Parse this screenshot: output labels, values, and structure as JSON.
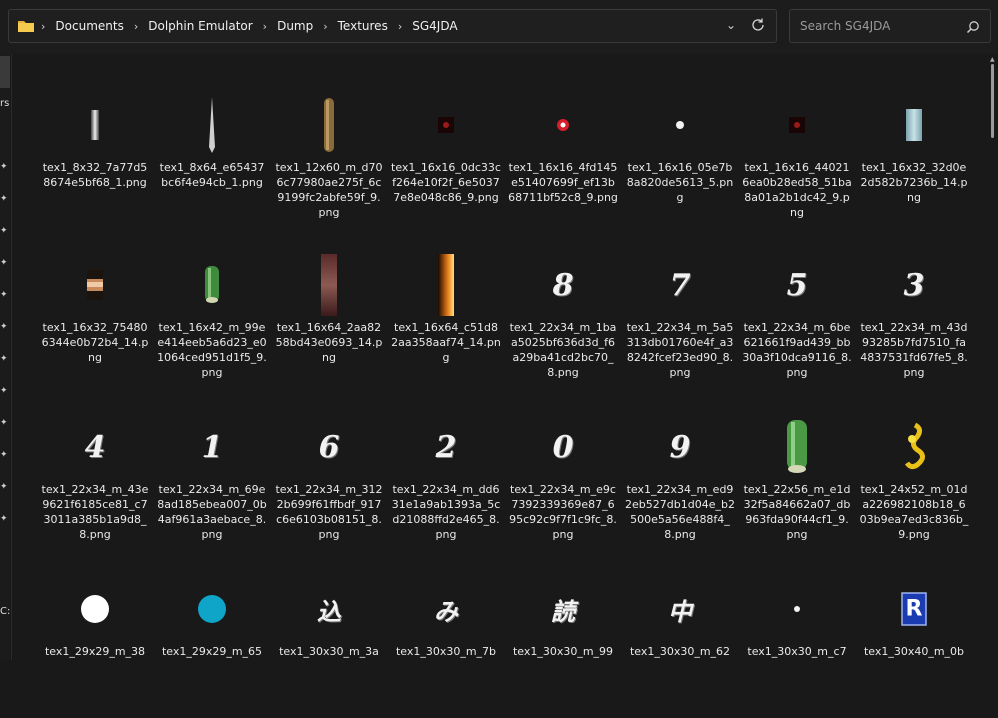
{
  "breadcrumbs": [
    "Documents",
    "Dolphin Emulator",
    "Dump",
    "Textures",
    "SG4JDA"
  ],
  "search": {
    "placeholder": "Search SG4JDA"
  },
  "left_pane": {
    "cut_text_1": "rs",
    "cut_text_2": "C:"
  },
  "icons": {
    "folder": "folder-icon",
    "dropdown": "chevron-down-icon",
    "refresh": "refresh-icon",
    "search": "search-icon",
    "pin": "pin-icon"
  },
  "files": [
    {
      "name": "tex1_8x32_7a77d58674e5bf68_1.png",
      "thumb": "bar-gray"
    },
    {
      "name": "tex1_8x64_e65437bc6f4e94cb_1.png",
      "thumb": "spike"
    },
    {
      "name": "tex1_12x60_m_d706c77980ae275f_6c9199fc2abfe59f_9.png",
      "thumb": "rod-brown"
    },
    {
      "name": "tex1_16x16_0dc33cf264e10f2f_6e50377e8e048c86_9.png",
      "thumb": "dot-dark-red"
    },
    {
      "name": "tex1_16x16_4fd145e51407699f_ef13b68711bf52c8_9.png",
      "thumb": "dot-red-glow"
    },
    {
      "name": "tex1_16x16_05e7b8a820de5613_5.png",
      "thumb": "dot-white"
    },
    {
      "name": "tex1_16x16_440216ea0b28ed58_51ba8a01a2b1dc42_9.png",
      "thumb": "dot-dark-red"
    },
    {
      "name": "tex1_16x32_32d0e2d582b7236b_14.png",
      "thumb": "bar-blue"
    },
    {
      "name": "tex1_16x32_754806344e0b72b4_14.png",
      "thumb": "bar-copper"
    },
    {
      "name": "tex1_16x42_m_99ee414eeb5a6d23_e01064ced951d1f5_9.png",
      "thumb": "cylinder-green-small"
    },
    {
      "name": "tex1_16x64_2aa8258bd43e0693_14.png",
      "thumb": "bar-dark-red"
    },
    {
      "name": "tex1_16x64_c51d82aa358aaf74_14.png",
      "thumb": "bar-fire"
    },
    {
      "name": "tex1_22x34_m_1baa5025bf636d3d_f6a29ba41cd2bc70_8.png",
      "thumb": "glyph",
      "glyph": "8"
    },
    {
      "name": "tex1_22x34_m_5a5313db01760e4f_a38242fcef23ed90_8.png",
      "thumb": "glyph",
      "glyph": "7"
    },
    {
      "name": "tex1_22x34_m_6be621661f9ad439_bb30a3f10dca9116_8.png",
      "thumb": "glyph",
      "glyph": "5"
    },
    {
      "name": "tex1_22x34_m_43d93285b7fd7510_fa4837531fd67fe5_8.png",
      "thumb": "glyph",
      "glyph": "3"
    },
    {
      "name": "tex1_22x34_m_43e9621f6185ce81_c73011a385b1a9d8_8.png",
      "thumb": "glyph",
      "glyph": "4"
    },
    {
      "name": "tex1_22x34_m_69e8ad185ebea007_0b4af961a3aebace_8.png",
      "thumb": "glyph",
      "glyph": "1"
    },
    {
      "name": "tex1_22x34_m_3122b699f61ffbdf_917c6e6103b08151_8.png",
      "thumb": "glyph",
      "glyph": "6"
    },
    {
      "name": "tex1_22x34_m_dd631e1a9ab1393a_5cd21088ffd2e465_8.png",
      "thumb": "glyph",
      "glyph": "2"
    },
    {
      "name": "tex1_22x34_m_e9c7392339369e87_695c92c9f7f1c9fc_8.png",
      "thumb": "glyph",
      "glyph": "0"
    },
    {
      "name": "tex1_22x34_m_ed92eb527db1d04e_b2500e5a56e488f4_8.png",
      "thumb": "glyph",
      "glyph": "9"
    },
    {
      "name": "tex1_22x56_m_e1d32f5a84662a07_db963fda90f44cf1_9.png",
      "thumb": "cylinder-green-large"
    },
    {
      "name": "tex1_24x52_m_01da226982108b18_603b9ea7ed3c836b_9.png",
      "thumb": "gold-swirl"
    },
    {
      "name": "tex1_29x29_m_38",
      "thumb": "circle-white"
    },
    {
      "name": "tex1_29x29_m_65",
      "thumb": "circle-cyan"
    },
    {
      "name": "tex1_30x30_m_3a",
      "thumb": "glyph",
      "glyph": "込"
    },
    {
      "name": "tex1_30x30_m_7b",
      "thumb": "glyph",
      "glyph": "み"
    },
    {
      "name": "tex1_30x30_m_99",
      "thumb": "glyph",
      "glyph": "読"
    },
    {
      "name": "tex1_30x30_m_62",
      "thumb": "glyph",
      "glyph": "中"
    },
    {
      "name": "tex1_30x30_m_c7",
      "thumb": "dot-white-small"
    },
    {
      "name": "tex1_30x40_m_0b",
      "thumb": "r-logo"
    }
  ]
}
